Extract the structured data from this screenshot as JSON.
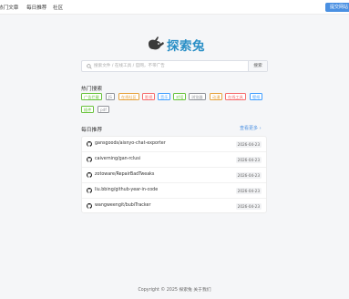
{
  "nav": {
    "items": [
      "热门文章",
      "每日推荐",
      "社区"
    ],
    "submit_label": "提交网站"
  },
  "logo": {
    "text": "探索兔",
    "icon": "rabbit-icon",
    "color": "#2a8fc6"
  },
  "search": {
    "placeholder": "搜索文件 / 在线工具 / 官网，不带广告",
    "button_label": "搜索",
    "icon": "search-icon"
  },
  "hot": {
    "title": "热门搜索",
    "tags": [
      {
        "label": "广告拦截",
        "color": "#67c23a"
      },
      {
        "label": "JS",
        "color": "#909399"
      },
      {
        "label": "在线社区",
        "color": "#e6a23c"
      },
      {
        "label": "影视",
        "color": "#f56c6c"
      },
      {
        "label": "音乐",
        "color": "#409eff"
      },
      {
        "label": "对话",
        "color": "#67c23a"
      },
      {
        "label": "浏览器",
        "color": "#909399"
      },
      {
        "label": "动漫",
        "color": "#e6a23c"
      },
      {
        "label": "在线工具",
        "color": "#f56c6c"
      },
      {
        "label": "壁纸",
        "color": "#409eff"
      },
      {
        "label": "插件",
        "color": "#67c23a"
      },
      {
        "label": "pdf",
        "color": "#909399"
      }
    ]
  },
  "daily": {
    "title": "每日推荐",
    "more_label": "查看更多 ›",
    "items": [
      {
        "repo": "gansgoods/aisnyo-chat-exporter",
        "date": "2026-04-23"
      },
      {
        "repo": "caiverning/gan-rclusi",
        "date": "2026-04-23"
      },
      {
        "repo": "zotoware/RepairBadTweaks",
        "date": "2026-04-23"
      },
      {
        "repo": "liu.bbing/github-year-in-code",
        "date": "2026-04-23"
      },
      {
        "repo": "wangweengit/bubiTracker",
        "date": "2026-04-23"
      }
    ]
  },
  "footer": {
    "text": "Copyright © 2025 探索兔  关于我们"
  },
  "colors": {
    "primary": "#4a90e2",
    "background": "#f5f6f8"
  }
}
